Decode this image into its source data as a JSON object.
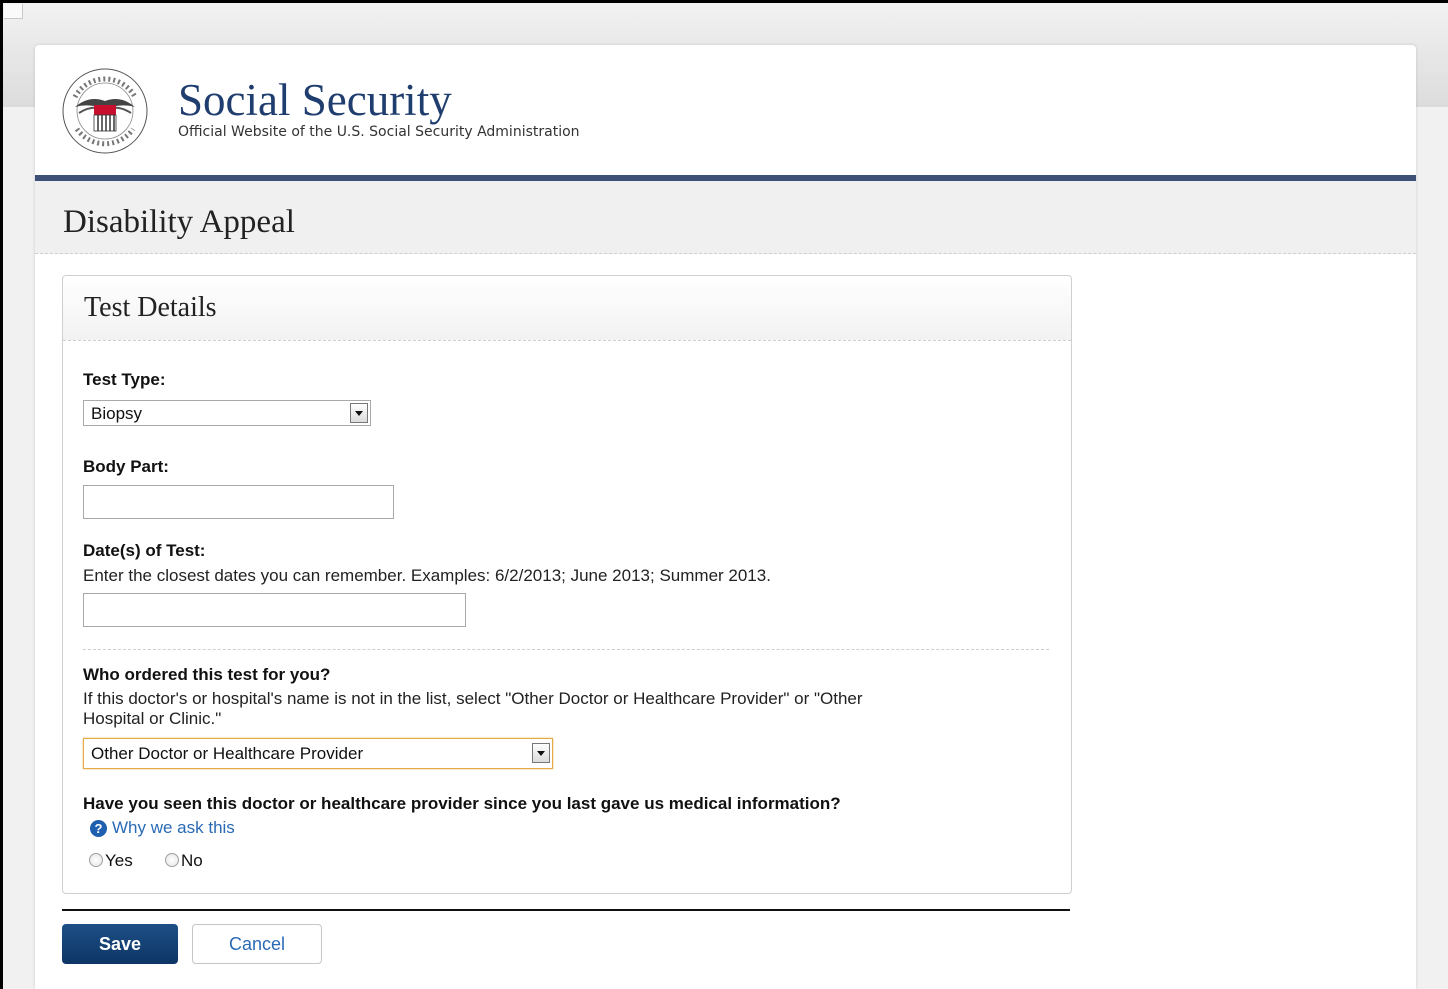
{
  "header": {
    "seal_logo": "Social Security Administration USA seal",
    "title": "Social Security",
    "subtitle": "Official Website of the U.S. Social Security Administration"
  },
  "page": {
    "title": "Disability Appeal"
  },
  "panel": {
    "title": "Test Details"
  },
  "form": {
    "test_type": {
      "label": "Test Type:",
      "value": "Biopsy"
    },
    "body_part": {
      "label": "Body Part:",
      "value": ""
    },
    "dates": {
      "label": "Date(s) of Test:",
      "help": "Enter the closest dates you can remember. Examples: 6/2/2013; June 2013; Summer 2013.",
      "value": ""
    },
    "ordered_by": {
      "label": "Who ordered this test for you?",
      "help_line1": "If this doctor's or hospital's name is not in the list, select \"Other Doctor or Healthcare Provider\" or \"Other",
      "help_line2": "Hospital or Clinic.\"",
      "value": "Other Doctor or Healthcare Provider"
    },
    "seen_since": {
      "label": "Have you seen this doctor or healthcare provider since you last gave us medical information?",
      "why_link": "Why we ask this",
      "yes": "Yes",
      "no": "No"
    }
  },
  "buttons": {
    "save": "Save",
    "cancel": "Cancel"
  },
  "colors": {
    "brand_navy": "#1f3d6e",
    "rule": "#3d5176",
    "link": "#2a6ab5",
    "save_button": "#16477c"
  },
  "icons": {
    "help": "question-circle-icon",
    "dropdown": "chevron-down-icon"
  }
}
